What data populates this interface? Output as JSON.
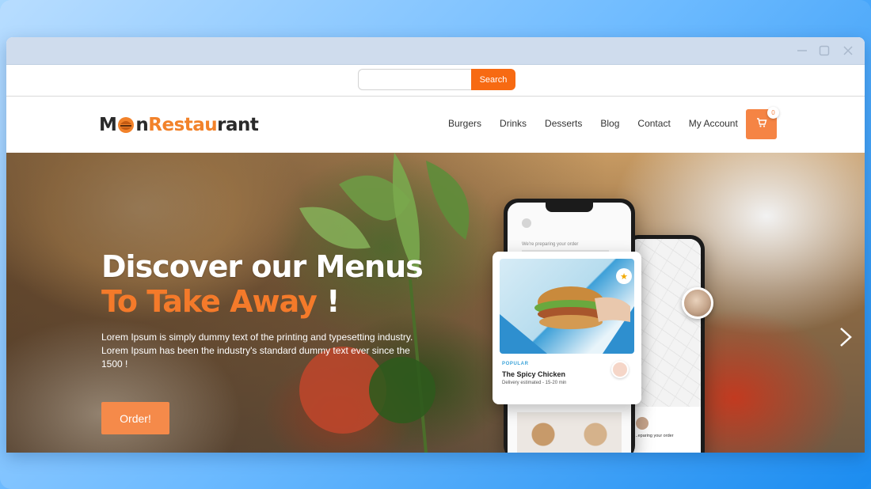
{
  "search": {
    "placeholder": "",
    "button_label": "Search"
  },
  "logo": {
    "part1": "M",
    "part2": "n ",
    "part3": "Restau",
    "part4": "rant"
  },
  "nav": {
    "items": [
      {
        "label": "Burgers"
      },
      {
        "label": "Drinks"
      },
      {
        "label": "Desserts"
      },
      {
        "label": "Blog"
      },
      {
        "label": "Contact"
      },
      {
        "label": "My Account"
      }
    ]
  },
  "cart": {
    "count": "0",
    "icon": "cart-icon"
  },
  "hero": {
    "title_line1": "Discover our Menus",
    "title_line2_accent": "To Take Away",
    "title_line2_end": " !",
    "description": "Lorem Ipsum is simply dummy text of the printing and typesetting industry. Lorem Ipsum has been the industry's standard dummy text ever since the 1500 !",
    "order_button": "Order!"
  },
  "mockup": {
    "preparing_text": "We're preparing your order",
    "preparing_text2": "...eparing your order",
    "card_tag": "POPULAR",
    "card_title": "The Spicy Chicken",
    "card_subtitle": "Delivery estimated - 15-20 min"
  },
  "colors": {
    "accent": "#f76a12",
    "accent_soft": "#f58444",
    "titlebar": "#cfdced"
  }
}
